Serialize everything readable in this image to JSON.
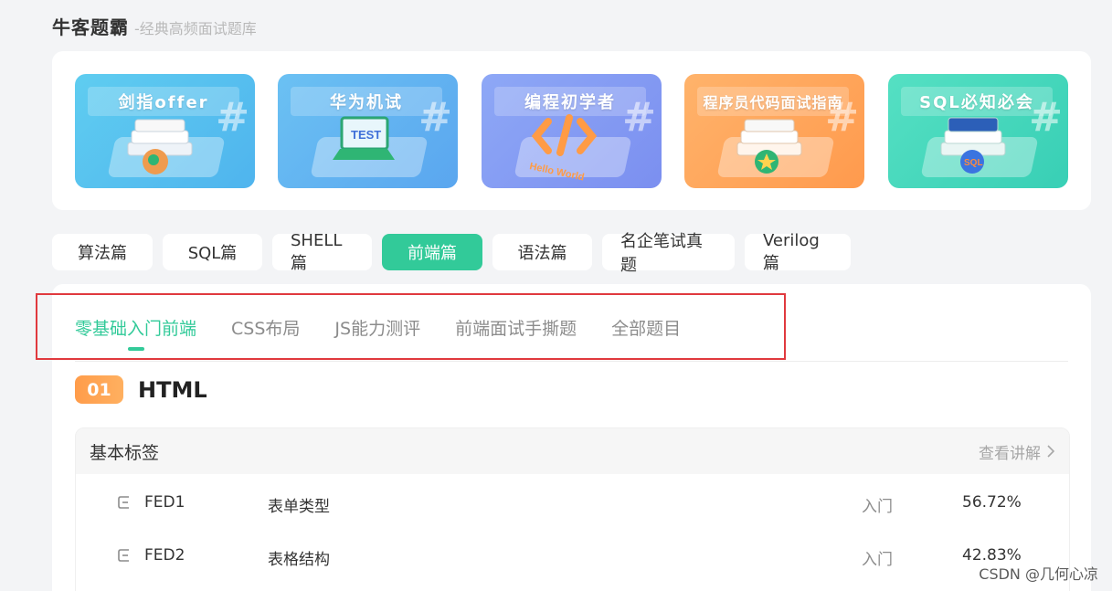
{
  "header": {
    "title": "牛客题霸",
    "subtitle": "-经典高频面试题库"
  },
  "banners": [
    {
      "label": "剑指offer",
      "icon": "book-stack-icon",
      "from": "#5fcdf0",
      "to": "#4fb4ee"
    },
    {
      "label": "华为机试",
      "icon": "laptop-test-icon",
      "from": "#6bc1f3",
      "to": "#5aa6ef"
    },
    {
      "label": "编程初学者",
      "icon": "code-brackets-icon",
      "from": "#8ea8f6",
      "to": "#7b8ff0"
    },
    {
      "label": "程序员代码面试指南",
      "icon": "book-stack-icon",
      "from": "#ffb36b",
      "to": "#ff9a4d"
    },
    {
      "label": "SQL必知必会",
      "icon": "sql-book-icon",
      "from": "#55e0c3",
      "to": "#38cfb5"
    }
  ],
  "category_tabs": [
    {
      "label": "算法篇",
      "active": false
    },
    {
      "label": "SQL篇",
      "active": false
    },
    {
      "label": "SHELL篇",
      "active": false
    },
    {
      "label": "前端篇",
      "active": true
    },
    {
      "label": "语法篇",
      "active": false
    },
    {
      "label": "名企笔试真题",
      "active": false
    },
    {
      "label": "Verilog篇",
      "active": false
    }
  ],
  "sub_tabs": [
    {
      "label": "零基础入门前端",
      "active": true
    },
    {
      "label": "CSS布局",
      "active": false
    },
    {
      "label": "JS能力测评",
      "active": false
    },
    {
      "label": "前端面试手撕题",
      "active": false
    },
    {
      "label": "全部题目",
      "active": false
    }
  ],
  "section": {
    "number": "01",
    "title": "HTML",
    "group_name": "基本标签",
    "more_label": "查看讲解",
    "rows": [
      {
        "id": "FED1",
        "name": "表单类型",
        "level": "入门",
        "rate": "56.72%"
      },
      {
        "id": "FED2",
        "name": "表格结构",
        "level": "入门",
        "rate": "42.83%"
      }
    ]
  },
  "watermark": "CSDN @几何心凉",
  "colors": {
    "accent": "#32ca99",
    "badge": "#ff9c4a",
    "annotation": "#e0393e"
  }
}
